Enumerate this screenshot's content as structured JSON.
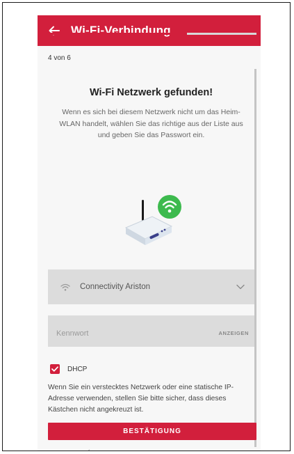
{
  "appbar": {
    "title": "Wi-Fi-Verbindung",
    "back_icon": "arrow-left-icon"
  },
  "progress": {
    "label": "4 von 6",
    "current": 4,
    "total": 6,
    "accent": "#d21f3c"
  },
  "main": {
    "heading": "Wi-Fi Netzwerk gefunden!",
    "description": "Wenn es sich bei diesem Netzwerk nicht um das Heim-WLAN handelt, wählen Sie das richtige aus der Liste aus und geben Sie das Passwort ein."
  },
  "network": {
    "selected": "Connectivity Ariston",
    "icon": "wifi-icon",
    "chevron": "chevron-down-icon"
  },
  "password": {
    "value": "",
    "placeholder": "Kennwort",
    "show_label": "ANZEIGEN"
  },
  "dhcp": {
    "label": "DHCP",
    "checked": true
  },
  "note": "Wenn Sie ein verstecktes Netzwerk oder eine statische IP-Adresse verwenden, stellen Sie bitte sicher, dass dieses Kästchen nicht angekreuzt ist.",
  "confirm_button": "BESTÄTIGUNG",
  "colors": {
    "brand": "#d21f3c",
    "wifi_badge": "#3dba4e",
    "field_bg": "#dcdcdc"
  }
}
